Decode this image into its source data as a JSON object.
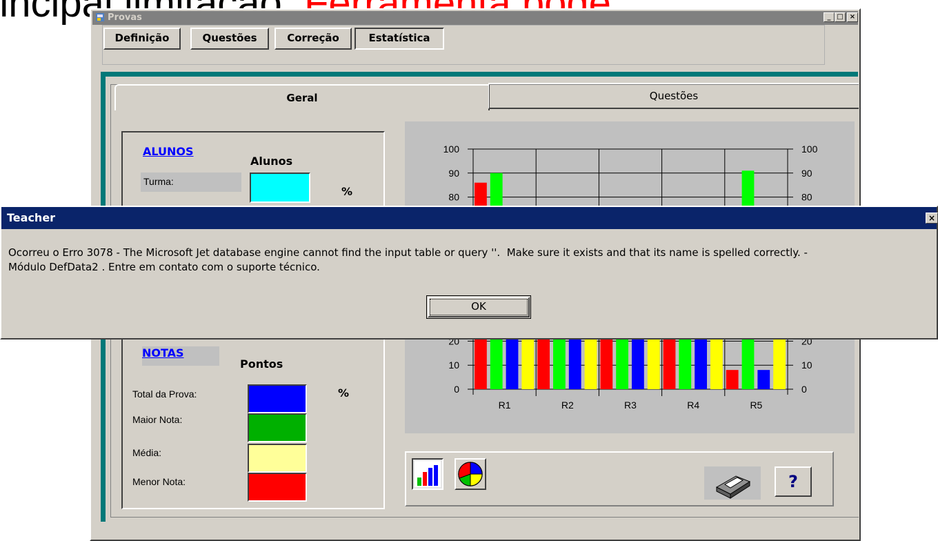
{
  "slide": {
    "title_black": "rincipal limitação: ",
    "title_red": "Ferramenta pode"
  },
  "window": {
    "title": "Provas",
    "icon": "app-icon",
    "controls": [
      "_",
      "□",
      "×"
    ]
  },
  "top_tabs": [
    "Definição",
    "Questões",
    "Correção",
    "Estatística"
  ],
  "sub_tabs": [
    "Geral",
    "Questões"
  ],
  "left_panel": {
    "alunos_link": "ALUNOS",
    "alunos_header": "Alunos",
    "turma_label": "Turma:",
    "percent": "%",
    "notas_link": "NOTAS",
    "pontos_header": "Pontos",
    "percent2": "%",
    "rows": [
      {
        "label": "Total da Prova:",
        "color": "#0000ff"
      },
      {
        "label": "Maior Nota:",
        "color": "#00b000"
      },
      {
        "label": "Média:",
        "color": "#ffff99"
      },
      {
        "label": "Menor Nota:",
        "color": "#ff0000"
      }
    ],
    "turma_color": "#00ffff"
  },
  "chart_data": {
    "type": "bar",
    "categories": [
      "R1",
      "R2",
      "R3",
      "R4",
      "R5"
    ],
    "ylim": [
      0,
      100
    ],
    "yticks": [
      0,
      10,
      20,
      80,
      90,
      100
    ],
    "series": [
      {
        "color": "#ff0000",
        "values": [
          86,
          25,
          25,
          25,
          8
        ]
      },
      {
        "color": "#00ff00",
        "values": [
          90,
          25,
          25,
          25,
          91
        ]
      },
      {
        "color": "#0000ff",
        "values": [
          25,
          25,
          25,
          25,
          8
        ]
      },
      {
        "color": "#ffff00",
        "values": [
          25,
          25,
          25,
          25,
          25
        ]
      }
    ]
  },
  "toolbar": {
    "bar_chart_icon": "bar-chart-icon",
    "pie_chart_icon": "pie-chart-icon",
    "printer_icon": "printer-icon",
    "help_label": "?"
  },
  "dialog": {
    "title": "Teacher",
    "close": "×",
    "message": "Ocorreu o Erro 3078 - The Microsoft Jet database engine cannot find the input table or query ''.  Make sure it exists and that its name is spelled correctly. -\nMódulo DefData2 . Entre em contato com o suporte técnico.",
    "ok_label": "OK"
  }
}
